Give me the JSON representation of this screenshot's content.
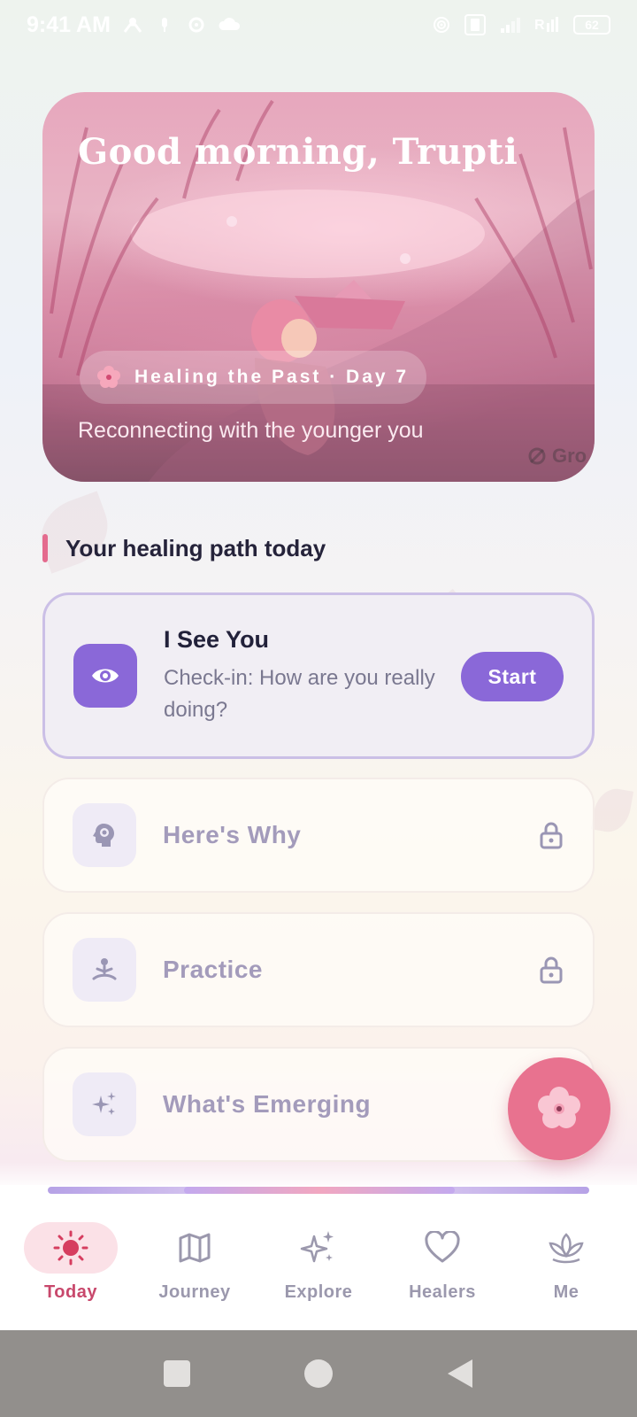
{
  "status_bar": {
    "time": "9:41 AM",
    "battery": "62",
    "left_icons": [
      "lock-person-icon",
      "mic-icon",
      "settings-icon",
      "cloud-icon"
    ],
    "right_icons": [
      "hotspot-icon",
      "vibrate-icon",
      "signal-icon",
      "roaming-icon",
      "battery-icon"
    ]
  },
  "hero": {
    "greeting": "Good morning, Trupti",
    "program": "Healing the Past · Day 7",
    "subtitle": "Reconnecting with the younger you",
    "watermark": "Gro"
  },
  "section": {
    "title": "Your healing path today"
  },
  "steps": [
    {
      "title": "I See You",
      "subtitle": "Check-in: How are you really doing?",
      "action": "Start",
      "icon": "eye-icon",
      "locked": false
    },
    {
      "title": "Here's Why",
      "icon": "head-gear-icon",
      "locked": true
    },
    {
      "title": "Practice",
      "icon": "meditation-icon",
      "locked": true
    },
    {
      "title": "What's Emerging",
      "icon": "sparkle-icon",
      "locked": true
    }
  ],
  "fab": {
    "icon": "flower-icon"
  },
  "nav": {
    "items": [
      {
        "label": "Today",
        "icon": "sun-icon",
        "active": true
      },
      {
        "label": "Journey",
        "icon": "map-icon",
        "active": false
      },
      {
        "label": "Explore",
        "icon": "sparkles-icon",
        "active": false
      },
      {
        "label": "Healers",
        "icon": "heart-icon",
        "active": false
      },
      {
        "label": "Me",
        "icon": "lotus-icon",
        "active": false
      }
    ]
  },
  "colors": {
    "accent": "#8a68d8",
    "pink": "#e8728f",
    "active_nav": "#c8486c"
  }
}
